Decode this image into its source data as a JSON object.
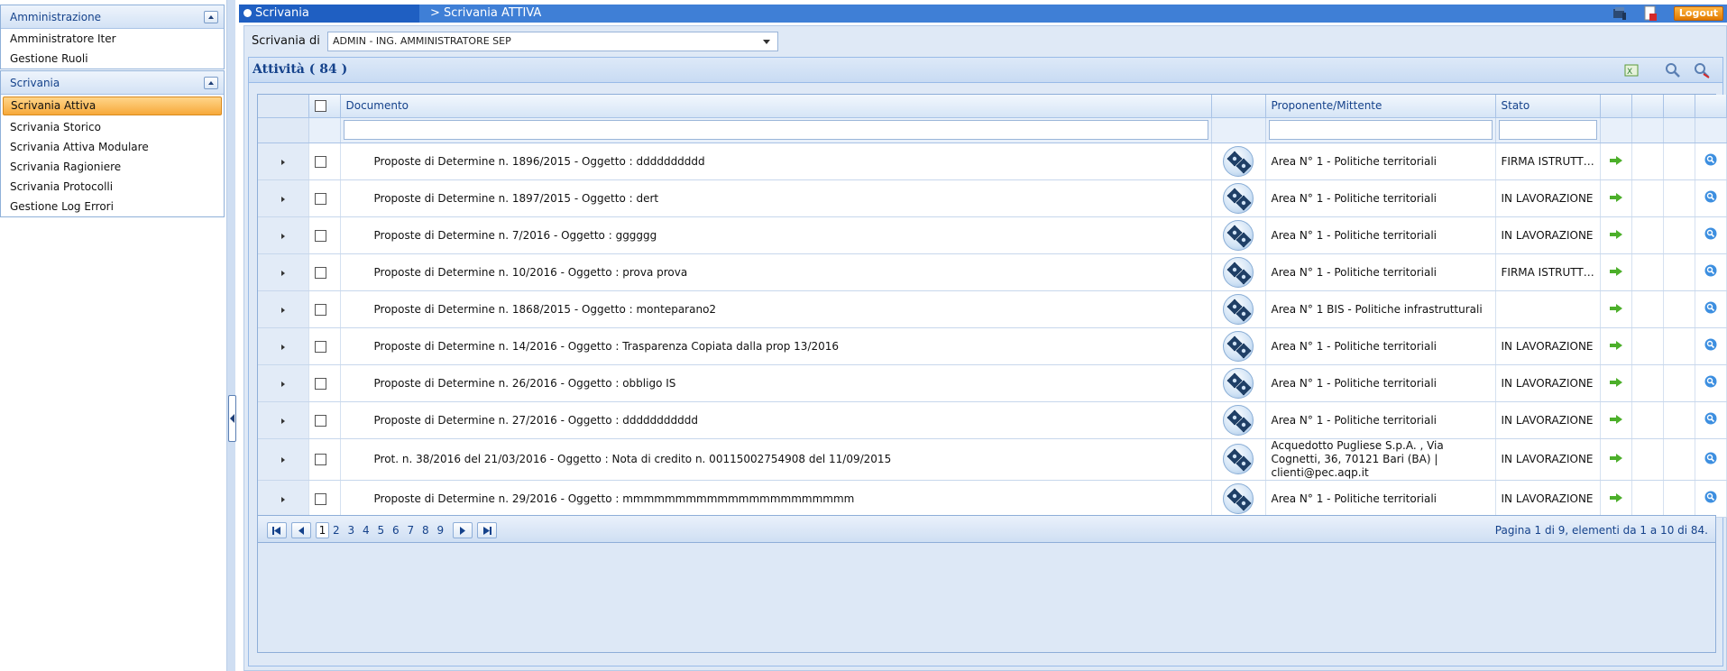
{
  "sidebar": {
    "sections": [
      {
        "title": "Amministrazione",
        "items": [
          "Amministratore Iter",
          "Gestione Ruoli"
        ]
      },
      {
        "title": "Scrivania",
        "items": [
          "Scrivania Attiva",
          "Scrivania Storico",
          "Scrivania Attiva Modulare",
          "Scrivania Ragioniere",
          "Scrivania Protocolli",
          "Gestione Log Errori"
        ],
        "active": "Scrivania Attiva"
      }
    ]
  },
  "topbar": {
    "tab": "Scrivania",
    "breadcrumb": "> Scrivania ATTIVA",
    "logout_label": "Logout",
    "accent_color": "#3f7fd6"
  },
  "filter": {
    "label": "Scrivania di",
    "selected": "ADMIN - ING. AMMINISTRATORE SEP"
  },
  "grid": {
    "title": "Attività ( 84 )",
    "columns": [
      "Documento",
      "Proponente/Mittente",
      "Stato"
    ],
    "rows": [
      {
        "documento": "Proposte di Determine n. 1896/2015 - Oggetto : dddddddddd",
        "proponente": "Area N° 1 - Politiche territoriali",
        "stato": "FIRMA ISTRUTTORE"
      },
      {
        "documento": "Proposte di Determine n. 1897/2015 - Oggetto : dert",
        "proponente": "Area N° 1 - Politiche territoriali",
        "stato": "IN LAVORAZIONE"
      },
      {
        "documento": "Proposte di Determine n. 7/2016 - Oggetto : gggggg",
        "proponente": "Area N° 1 - Politiche territoriali",
        "stato": "IN LAVORAZIONE"
      },
      {
        "documento": "Proposte di Determine n. 10/2016 - Oggetto : prova prova",
        "proponente": "Area N° 1 - Politiche territoriali",
        "stato": "FIRMA ISTRUTTORE"
      },
      {
        "documento": "Proposte di Determine n. 1868/2015 - Oggetto : monteparano2",
        "proponente": "Area N° 1 BIS - Politiche infrastrutturali",
        "stato": ""
      },
      {
        "documento": "Proposte di Determine n. 14/2016 - Oggetto : Trasparenza Copiata dalla prop 13/2016",
        "proponente": "Area N° 1 - Politiche territoriali",
        "stato": "IN LAVORAZIONE"
      },
      {
        "documento": "Proposte di Determine n. 26/2016 - Oggetto : obbligo IS",
        "proponente": "Area N° 1 - Politiche territoriali",
        "stato": "IN LAVORAZIONE"
      },
      {
        "documento": "Proposte di Determine n. 27/2016 - Oggetto : ddddddddddd",
        "proponente": "Area N° 1 - Politiche territoriali",
        "stato": "IN LAVORAZIONE"
      },
      {
        "documento": "Prot. n. 38/2016 del 21/03/2016 - Oggetto : Nota di credito n. 00115002754908 del 11/09/2015",
        "proponente": "Acquedotto Pugliese S.p.A. , Via Cognetti, 36, 70121 Bari (BA) | clienti@pec.aqp.it",
        "stato": "IN LAVORAZIONE"
      },
      {
        "documento": "Proposte di Determine n. 29/2016 - Oggetto : mmmmmmmmmmmmmmmmmmmmmm",
        "proponente": "Area N° 1 - Politiche territoriali",
        "stato": "IN LAVORAZIONE"
      }
    ]
  },
  "pager": {
    "pages": [
      "1",
      "2",
      "3",
      "4",
      "5",
      "6",
      "7",
      "8",
      "9"
    ],
    "current": "1",
    "info": "Pagina 1 di 9, elementi da 1 a 10 di 84."
  }
}
